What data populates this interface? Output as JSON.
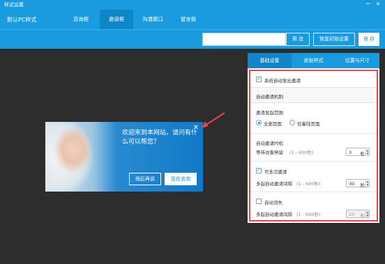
{
  "titlebar": {
    "title": "样式设置",
    "min_glyph": "−",
    "close_glyph": "✕"
  },
  "topnav": {
    "brand": "默认PC样式",
    "tabs": [
      {
        "label": "咨询框"
      },
      {
        "label": "邀请框"
      },
      {
        "label": "沟通窗口"
      },
      {
        "label": "留言板"
      }
    ]
  },
  "toolbar": {
    "search_value": "",
    "preview_label": "预 览",
    "reset_label": "恢复初始设置",
    "save_label": "保 存"
  },
  "invite": {
    "message": "欢迎来到本网站，请问有什么可以帮您？",
    "close_glyph": "✕",
    "later_label": "稍后再说",
    "consult_label": "现在咨询"
  },
  "panel": {
    "tabs": [
      {
        "label": "基础设置"
      },
      {
        "label": "皮肤样式"
      },
      {
        "label": "位置与尺寸"
      }
    ],
    "auto_invite_label": "系统自动发出邀请",
    "auto_invite_checked": true,
    "section_title": "自动邀请机制",
    "scope_label": "邀请发起范围",
    "scope_all": "全部页面",
    "scope_home": "仅着陆页面",
    "timing_label": "自动邀请时机",
    "wait_label": "等待访客停留",
    "wait_range": "(1 - 600秒)",
    "wait_value": "3",
    "unit_sec": "秒",
    "repeat_label": "可多次邀请",
    "repeat_checked": true,
    "repeat_interval_label": "多起自动邀请间隔",
    "repeat_range": "(1 - 600秒)",
    "repeat_value": "30",
    "auto_close_label": "自动消失",
    "auto_close_checked": false,
    "close_interval_label": "多起自动邀请间隔",
    "close_range": "(1 - 600秒)",
    "close_value": "20"
  },
  "colors": {
    "accent": "#1a9be0",
    "active_tab": "#0e86c8",
    "highlight_border": "#e8434f",
    "background": "#2d2d2d"
  }
}
